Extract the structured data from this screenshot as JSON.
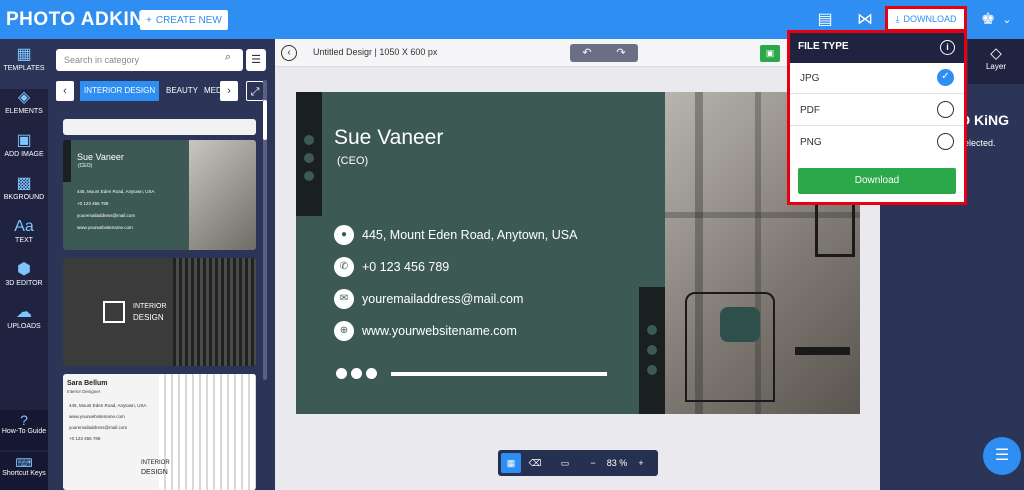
{
  "app": {
    "logo": "PHOTO ADKING",
    "create_label": "CREATE NEW",
    "download_label": "DOWNLOAD"
  },
  "nav": {
    "items": [
      {
        "label": "TEMPLATES",
        "icon": "templates-icon"
      },
      {
        "label": "ELEMENTS",
        "icon": "elements-icon"
      },
      {
        "label": "ADD IMAGE",
        "icon": "image-icon"
      },
      {
        "label": "BKGROUND",
        "icon": "background-icon"
      },
      {
        "label": "TEXT",
        "icon": "text-icon"
      },
      {
        "label": "3D EDITOR",
        "icon": "cube-icon"
      },
      {
        "label": "UPLOADS",
        "icon": "upload-icon"
      }
    ],
    "guide": "How-To Guide",
    "keys": "Shortcut Keys"
  },
  "panel": {
    "search_placeholder": "Search in category",
    "categories": [
      "INTERIOR DESIGN",
      "BEAUTY",
      "MEDI"
    ]
  },
  "thumbs": {
    "t1": {
      "name": "Sue Vaneer",
      "role": "(CEO)",
      "rows": [
        "445, Mount Eden Road, Anytown, USA",
        "+0 123 456 789",
        "youremailaddress@mail.com",
        "www.yourwebsitename.com"
      ]
    },
    "t2": {
      "brand1": "INTERIOR",
      "brand2": "DESIGN"
    },
    "t3": {
      "name": "Sara Bellum",
      "role": "Interior Designer",
      "rows": [
        "445, Mount Eden Road, Anytown, USA",
        "www.yourwebsitename.com",
        "youremailaddress@mail.com",
        "+0 123 456 789"
      ],
      "brand1": "INTERIOR",
      "brand2": "DESIGN"
    }
  },
  "doc": {
    "title": "Untitled Desigr",
    "size": "1050 X 600 px"
  },
  "card": {
    "name": "Sue Vaneer",
    "role": "(CEO)",
    "address": "445, Mount Eden Road, Anytown, USA",
    "phone": "+0 123 456 789",
    "email": "youremailaddress@mail.com",
    "website": "www.yourwebsitename.com"
  },
  "zoom": {
    "value": "83 %"
  },
  "right": {
    "layer_label": "Layer",
    "brand": "D KiNG",
    "note": "elected."
  },
  "download_menu": {
    "title": "FILE TYPE",
    "options": [
      {
        "label": "JPG",
        "selected": true
      },
      {
        "label": "PDF",
        "selected": false
      },
      {
        "label": "PNG",
        "selected": false
      }
    ],
    "button": "Download"
  }
}
